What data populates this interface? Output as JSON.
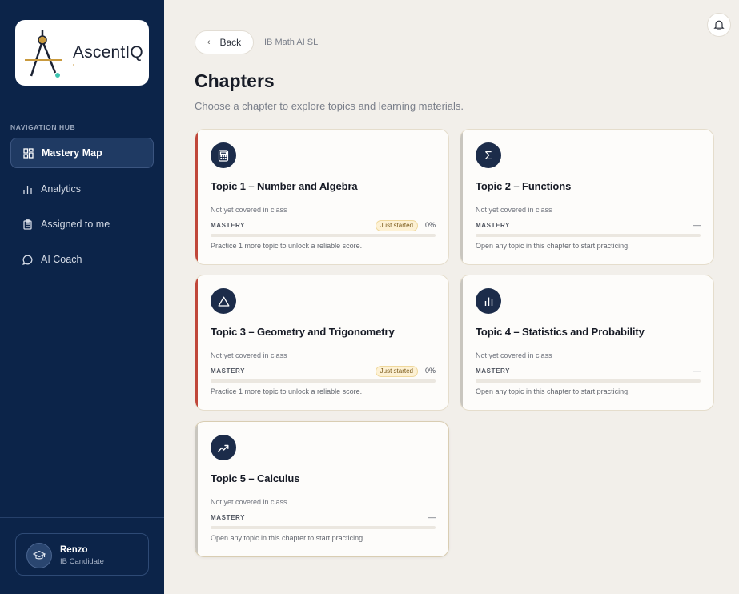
{
  "brand": {
    "name": "AscentIQ"
  },
  "sidebar": {
    "section_label": "NAVIGATION HUB",
    "items": [
      {
        "label": "Mastery Map",
        "icon": "grid-icon",
        "active": true
      },
      {
        "label": "Analytics",
        "icon": "bar-chart-icon",
        "active": false
      },
      {
        "label": "Assigned to me",
        "icon": "clipboard-icon",
        "active": false
      },
      {
        "label": "AI Coach",
        "icon": "chat-bubble-icon",
        "active": false
      }
    ],
    "user": {
      "name": "Renzo",
      "role": "IB Candidate"
    }
  },
  "header": {
    "back_label": "Back",
    "breadcrumb": "IB Math AI SL",
    "title": "Chapters",
    "subtitle": "Choose a chapter to explore topics and learning materials."
  },
  "chapters": [
    {
      "title": "Topic 1 – Number and Algebra",
      "icon": "calculator-icon",
      "status": "Not yet covered in class",
      "mastery_label": "MASTERY",
      "badge": "Just started",
      "value": "0%",
      "hint": "Practice 1 more topic to unlock a reliable score.",
      "accent": "#c0473a"
    },
    {
      "title": "Topic 2 – Functions",
      "icon": "sigma-icon",
      "status": "Not yet covered in class",
      "mastery_label": "MASTERY",
      "badge": "",
      "value": "—",
      "hint": "Open any topic in this chapter to start practicing.",
      "accent": "#c9c6bf"
    },
    {
      "title": "Topic 3 – Geometry and Trigonometry",
      "icon": "triangle-icon",
      "status": "Not yet covered in class",
      "mastery_label": "MASTERY",
      "badge": "Just started",
      "value": "0%",
      "hint": "Practice 1 more topic to unlock a reliable score.",
      "accent": "#c0473a"
    },
    {
      "title": "Topic 4 – Statistics and Probability",
      "icon": "bar-chart-icon",
      "status": "Not yet covered in class",
      "mastery_label": "MASTERY",
      "badge": "",
      "value": "—",
      "hint": "Open any topic in this chapter to start practicing.",
      "accent": "#c9c6bf"
    },
    {
      "title": "Topic 5 – Calculus",
      "icon": "trend-up-icon",
      "status": "Not yet covered in class",
      "mastery_label": "MASTERY",
      "badge": "",
      "value": "—",
      "hint": "Open any topic in this chapter to start practicing.",
      "accent": "#c9c6bf"
    }
  ]
}
